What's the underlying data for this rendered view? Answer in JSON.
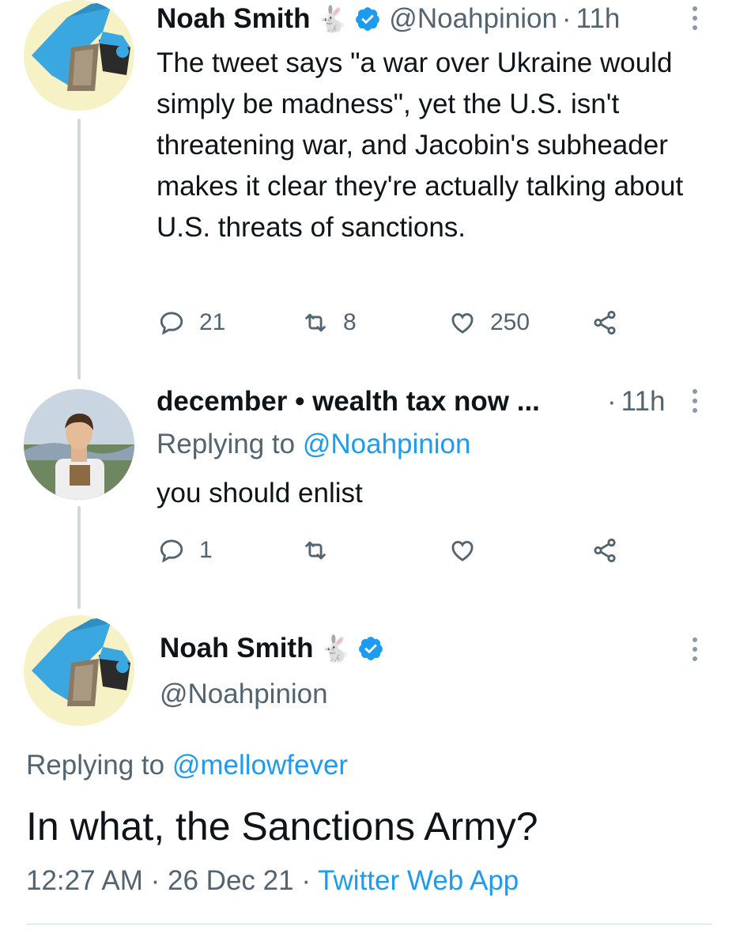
{
  "tweet1": {
    "name": "Noah Smith",
    "emoji": "🐇",
    "handle": "@Noahpinion",
    "sep": "·",
    "time": "11h",
    "text": "The tweet says \"a war over Ukraine would simply be madness\", yet the U.S. isn't threatening war, and Jacobin's subheader makes it clear they're actually talking about U.S. threats of sanctions.",
    "replies": "21",
    "retweets": "8",
    "likes": "250"
  },
  "tweet2": {
    "name": "december • wealth tax now ...",
    "sep": "·",
    "time": "11h",
    "replying_prefix": "Replying to ",
    "replying_to": "@Noahpinion",
    "text": "you should enlist",
    "replies": "1"
  },
  "main": {
    "name": "Noah Smith",
    "emoji": "🐇",
    "handle": "@Noahpinion",
    "replying_prefix": "Replying to ",
    "replying_to": "@mellowfever",
    "text": "In what, the Sanctions Army?",
    "time": "12:27 AM",
    "date": "26 Dec 21",
    "sep": "·",
    "source": "Twitter Web App"
  },
  "colors": {
    "accent": "#1d9bf0",
    "secondary_text": "#536471",
    "thread_line": "#cfd9de"
  }
}
